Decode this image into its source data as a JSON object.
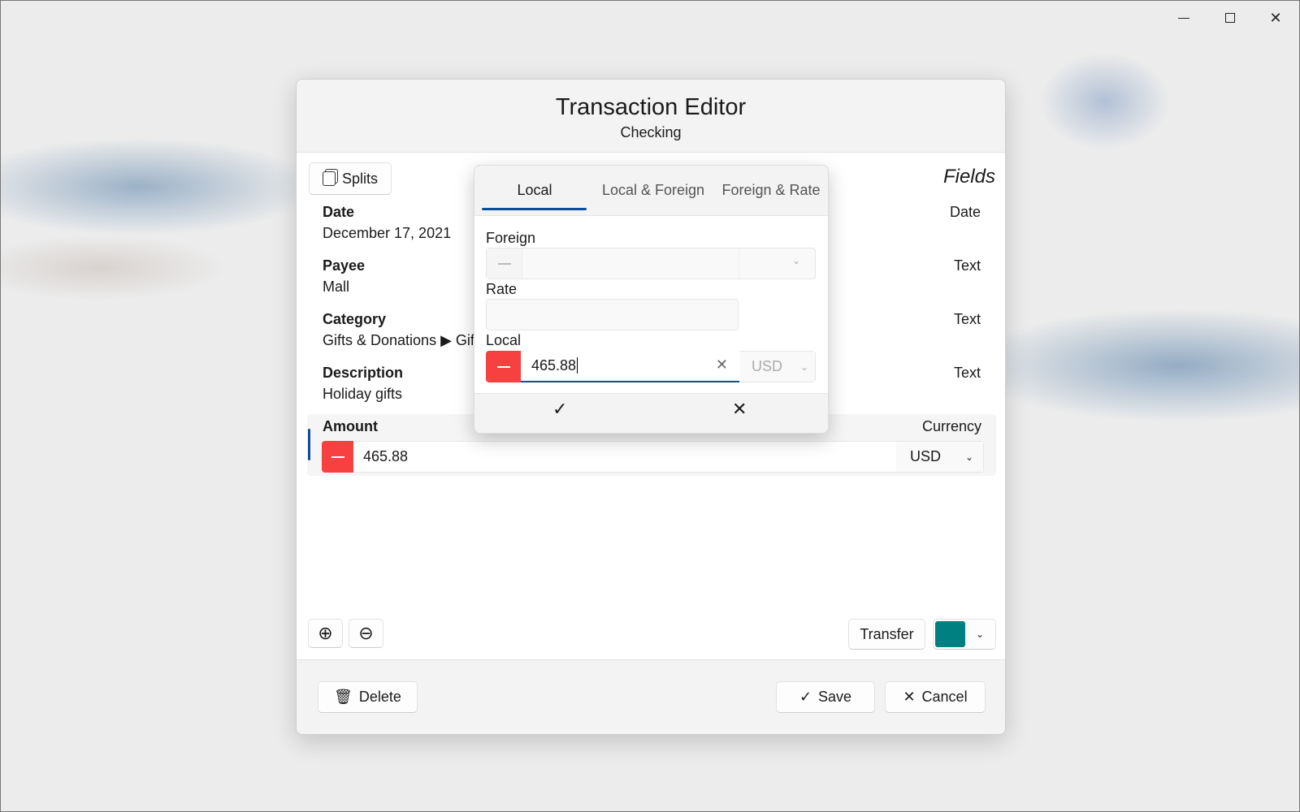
{
  "window": {
    "minimize": "—",
    "maximize": "☐",
    "close": "✕"
  },
  "dialog": {
    "title": "Transaction Editor",
    "subtitle": "Checking"
  },
  "toolbar": {
    "splits_label": "Splits",
    "fields_label": "Fields"
  },
  "fields": [
    {
      "label": "Date",
      "value": "December 17, 2021",
      "type": "Date"
    },
    {
      "label": "Payee",
      "value": "Mall",
      "type": "Text"
    },
    {
      "label": "Category",
      "value": "Gifts & Donations ▶ Gif",
      "type": "Text"
    },
    {
      "label": "Description",
      "value": "Holiday gifts",
      "type": "Text"
    }
  ],
  "amount": {
    "label": "Amount",
    "value": "465.88",
    "sign": "minus",
    "currency_label": "Currency",
    "currency": "USD"
  },
  "bottom": {
    "transfer_label": "Transfer",
    "color": "#008080"
  },
  "footer": {
    "delete_label": "Delete",
    "save_label": "Save",
    "cancel_label": "Cancel"
  },
  "popup": {
    "tabs": [
      "Local",
      "Local & Foreign",
      "Foreign & Rate"
    ],
    "active_tab": "Local",
    "foreign_label": "Foreign",
    "foreign_value": "",
    "foreign_currency": "",
    "rate_label": "Rate",
    "rate_value": "",
    "local_label": "Local",
    "local_value": "465.88",
    "local_currency": "USD"
  },
  "colors": {
    "accent": "#0f4c9a",
    "negative": "#f74040",
    "teal": "#008080"
  }
}
